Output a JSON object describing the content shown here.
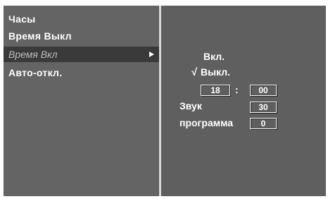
{
  "menu": {
    "items": [
      {
        "label": "Часы"
      },
      {
        "label": "Время Выкл"
      },
      {
        "label": "Время Вкл"
      },
      {
        "label": "Авто-откл."
      }
    ],
    "selected_index": 2
  },
  "timer_on": {
    "options": [
      {
        "label": "Вкл.",
        "checked": false
      },
      {
        "label": "Выкл.",
        "checked": true
      }
    ],
    "check_mark": "√",
    "hour": "18",
    "separator": ":",
    "minute": "00",
    "volume_label": "Звук",
    "volume_value": "30",
    "program_label": "программа",
    "program_value": "0"
  },
  "colors": {
    "menu_bg": "#646464",
    "selected_bg": "#3a3a3a",
    "text": "#ffffff"
  }
}
